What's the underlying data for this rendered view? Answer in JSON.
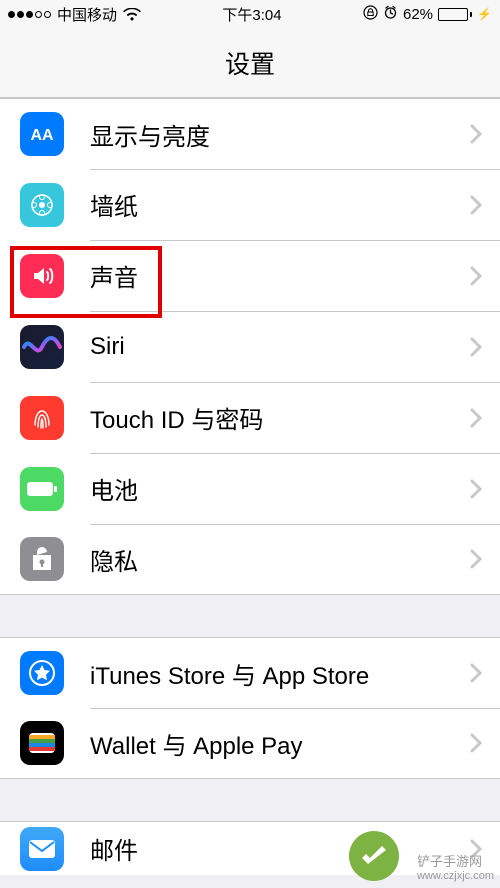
{
  "status": {
    "carrier": "中国移动",
    "time": "下午3:04",
    "battery_pct": "62%"
  },
  "nav": {
    "title": "设置"
  },
  "group1": {
    "items": [
      {
        "label": "显示与亮度",
        "icon": "display-icon",
        "bg": "#007aff"
      },
      {
        "label": "墙纸",
        "icon": "wallpaper-icon",
        "bg": "#36c7dc"
      },
      {
        "label": "声音",
        "icon": "sounds-icon",
        "bg": "#ff3b30"
      },
      {
        "label": "Siri",
        "icon": "siri-icon",
        "bg": "linear-gradient(135deg,#1e3a8a,#7c3aed,#ec4899,#f59e0b)"
      },
      {
        "label": "Touch ID 与密码",
        "icon": "touchid-icon",
        "bg": "#ff3b30"
      },
      {
        "label": "电池",
        "icon": "battery-icon",
        "bg": "#4cd964"
      },
      {
        "label": "隐私",
        "icon": "privacy-icon",
        "bg": "#8e8e93"
      }
    ]
  },
  "group2": {
    "items": [
      {
        "label": "iTunes Store 与 App Store",
        "icon": "appstore-icon",
        "bg": "#007aff"
      },
      {
        "label": "Wallet 与 Apple Pay",
        "icon": "wallet-icon",
        "bg": "#000"
      }
    ]
  },
  "group3": {
    "items": [
      {
        "label": "邮件",
        "icon": "mail-icon",
        "bg": "#1f8cff"
      }
    ]
  },
  "watermark": {
    "text": "铲子手游网",
    "url": "www.czjxjc.com"
  }
}
